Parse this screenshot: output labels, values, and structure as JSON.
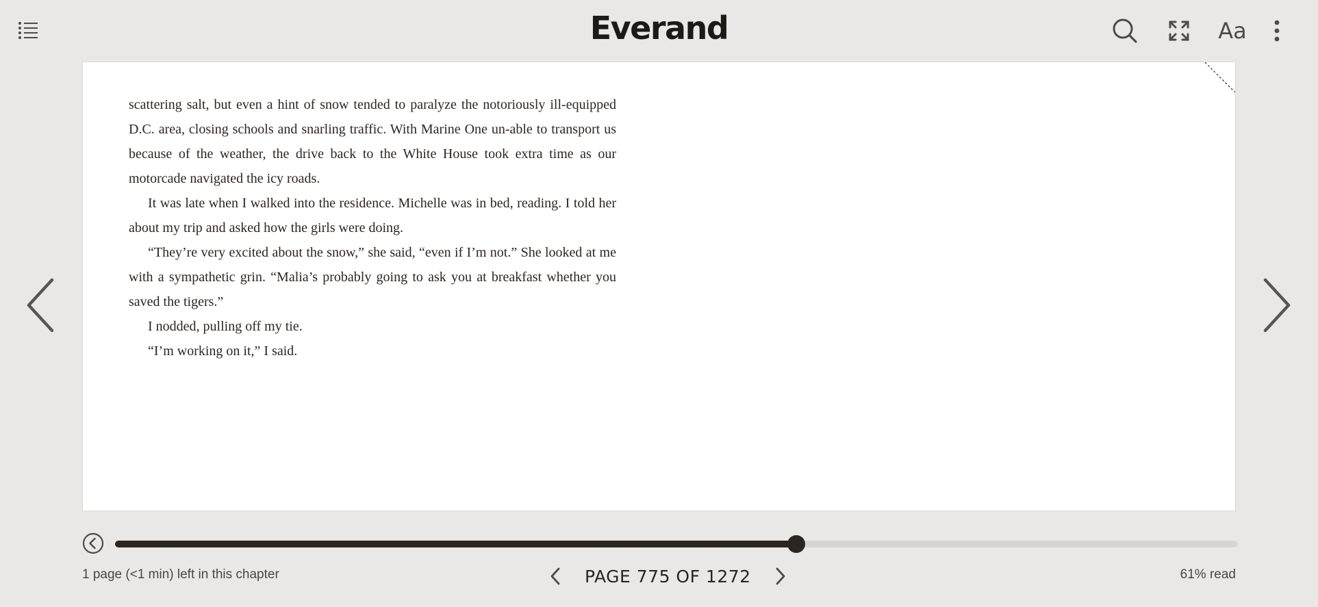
{
  "header": {
    "brand": "Everand",
    "font_settings_label": "Aa",
    "icons": [
      "list-icon",
      "search-icon",
      "fullscreen-icon",
      "more-vertical-icon"
    ]
  },
  "page": {
    "paragraphs": [
      {
        "indent": false,
        "text": "scattering salt, but even a hint of snow tended to paralyze the notoriously ill-equipped D.C. area, closing schools and snarling traffic. With Marine One un-able to transport us because of the weather, the drive back to the White House took extra time as our motorcade navigated the icy roads."
      },
      {
        "indent": true,
        "text": "It was late when I walked into the residence. Michelle was in bed, reading. I told her about my trip and asked how the girls were doing."
      },
      {
        "indent": true,
        "text": "“They’re very excited about the snow,” she said, “even if I’m not.” She looked at me with a sympathetic grin. “Malia’s probably going to ask you at breakfast whether you saved the tigers.”"
      },
      {
        "indent": true,
        "text": "I nodded, pulling off my tie."
      },
      {
        "indent": true,
        "text": "“I’m working on it,” I said."
      }
    ]
  },
  "footer": {
    "chapter_remaining": "1 page (<1 min) left in this chapter",
    "page_label": "PAGE 775 OF 1272",
    "percent_read": "61% read",
    "progress_fraction": 0.607
  },
  "colors": {
    "background": "#e9e8e6",
    "page": "#ffffff",
    "accent": "#2a2520",
    "track": "#d6d5d3"
  }
}
